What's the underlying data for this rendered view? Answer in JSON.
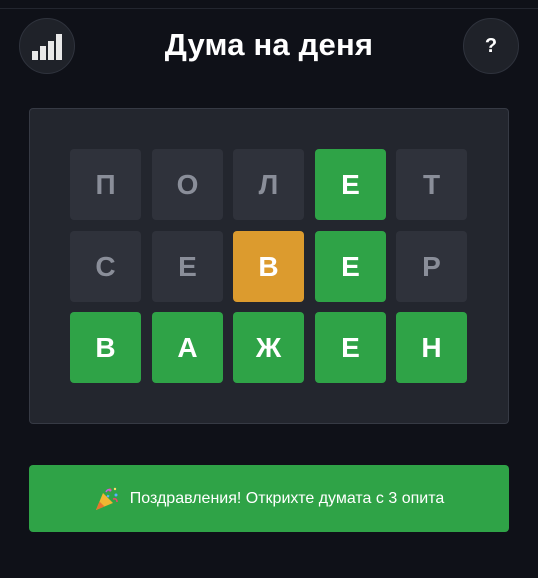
{
  "header": {
    "title": "Дума на деня",
    "stats_icon": "bar-chart-icon",
    "help_label": "?"
  },
  "board": {
    "rows": [
      [
        {
          "letter": "П",
          "state": "absent"
        },
        {
          "letter": "О",
          "state": "absent"
        },
        {
          "letter": "Л",
          "state": "absent"
        },
        {
          "letter": "Е",
          "state": "correct"
        },
        {
          "letter": "Т",
          "state": "absent"
        }
      ],
      [
        {
          "letter": "С",
          "state": "absent"
        },
        {
          "letter": "Е",
          "state": "absent"
        },
        {
          "letter": "В",
          "state": "present"
        },
        {
          "letter": "Е",
          "state": "correct"
        },
        {
          "letter": "Р",
          "state": "absent"
        }
      ],
      [
        {
          "letter": "В",
          "state": "correct"
        },
        {
          "letter": "А",
          "state": "correct"
        },
        {
          "letter": "Ж",
          "state": "correct"
        },
        {
          "letter": "Е",
          "state": "correct"
        },
        {
          "letter": "Н",
          "state": "correct"
        }
      ]
    ]
  },
  "message": {
    "icon": "party-popper-icon",
    "text": "Поздравления! Открихте думата с 3 опита"
  },
  "colors": {
    "background": "#0f1118",
    "board": "#23262e",
    "absent": "#2f323b",
    "correct": "#2fa347",
    "present": "#dc9b2e"
  }
}
